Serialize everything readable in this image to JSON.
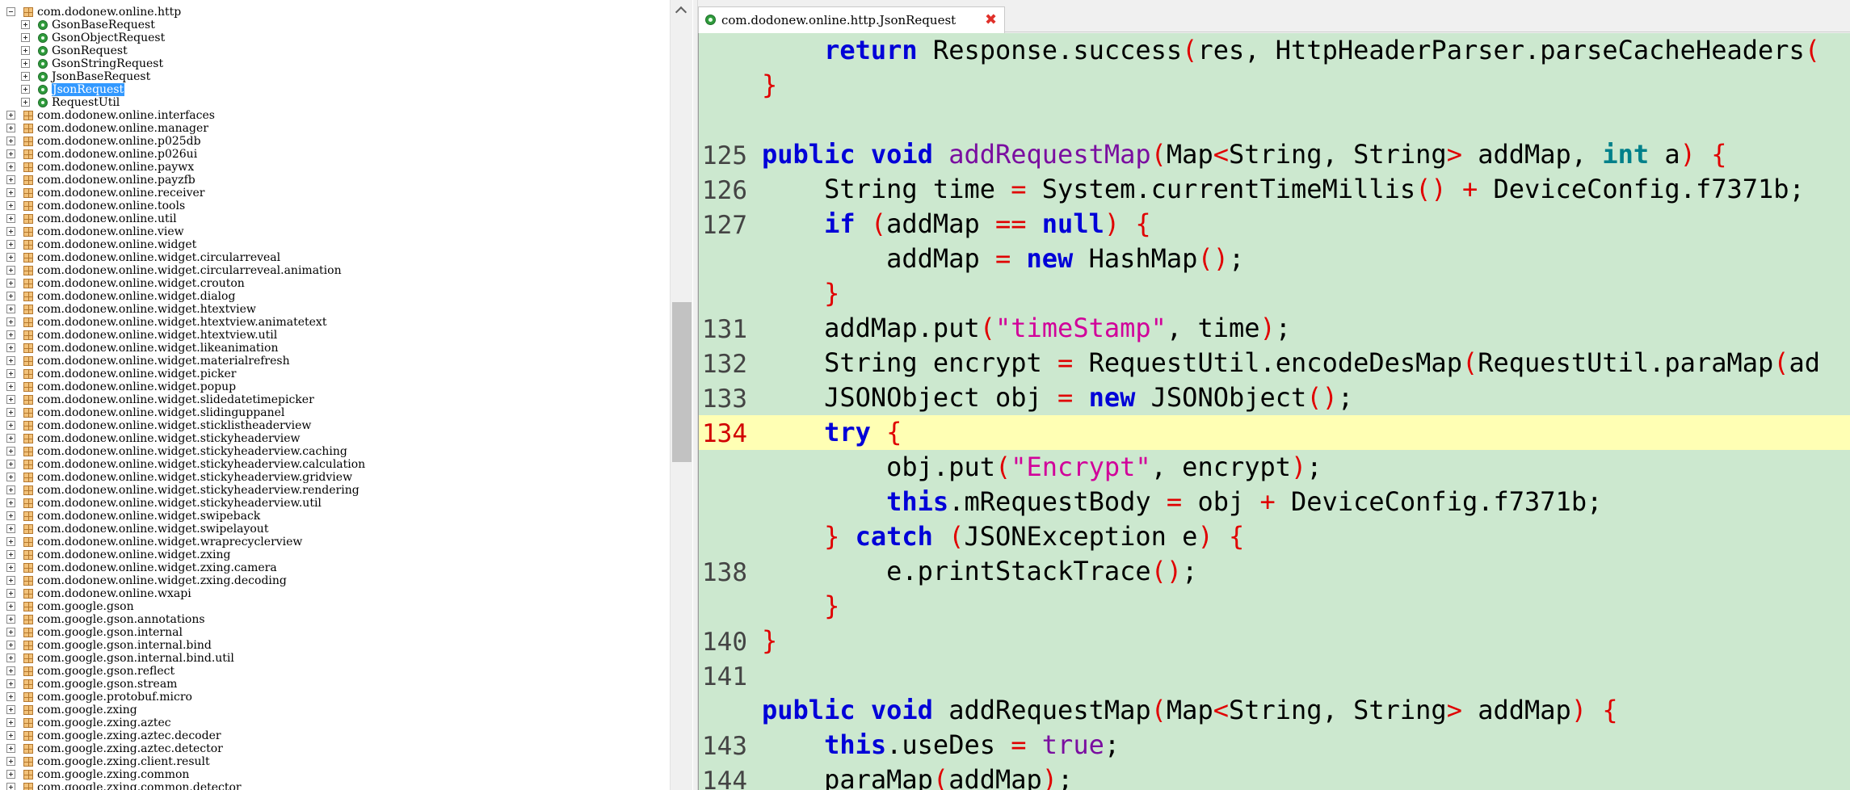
{
  "tree": {
    "items": [
      {
        "label": "com.dodonew.online.http",
        "kind": "package",
        "expanded": true
      },
      {
        "label": "GsonBaseRequest",
        "kind": "class"
      },
      {
        "label": "GsonObjectRequest",
        "kind": "class"
      },
      {
        "label": "GsonRequest",
        "kind": "class"
      },
      {
        "label": "GsonStringRequest",
        "kind": "class"
      },
      {
        "label": "JsonBaseRequest",
        "kind": "class"
      },
      {
        "label": "JsonRequest",
        "kind": "class",
        "selected": true
      },
      {
        "label": "RequestUtil",
        "kind": "class"
      },
      {
        "label": "com.dodonew.online.interfaces",
        "kind": "package"
      },
      {
        "label": "com.dodonew.online.manager",
        "kind": "package"
      },
      {
        "label": "com.dodonew.online.p025db",
        "kind": "package"
      },
      {
        "label": "com.dodonew.online.p026ui",
        "kind": "package"
      },
      {
        "label": "com.dodonew.online.paywx",
        "kind": "package"
      },
      {
        "label": "com.dodonew.online.payzfb",
        "kind": "package"
      },
      {
        "label": "com.dodonew.online.receiver",
        "kind": "package"
      },
      {
        "label": "com.dodonew.online.tools",
        "kind": "package"
      },
      {
        "label": "com.dodonew.online.util",
        "kind": "package"
      },
      {
        "label": "com.dodonew.online.view",
        "kind": "package"
      },
      {
        "label": "com.dodonew.online.widget",
        "kind": "package"
      },
      {
        "label": "com.dodonew.online.widget.circularreveal",
        "kind": "package"
      },
      {
        "label": "com.dodonew.online.widget.circularreveal.animation",
        "kind": "package"
      },
      {
        "label": "com.dodonew.online.widget.crouton",
        "kind": "package"
      },
      {
        "label": "com.dodonew.online.widget.dialog",
        "kind": "package"
      },
      {
        "label": "com.dodonew.online.widget.htextview",
        "kind": "package"
      },
      {
        "label": "com.dodonew.online.widget.htextview.animatetext",
        "kind": "package"
      },
      {
        "label": "com.dodonew.online.widget.htextview.util",
        "kind": "package"
      },
      {
        "label": "com.dodonew.online.widget.likeanimation",
        "kind": "package"
      },
      {
        "label": "com.dodonew.online.widget.materialrefresh",
        "kind": "package"
      },
      {
        "label": "com.dodonew.online.widget.picker",
        "kind": "package"
      },
      {
        "label": "com.dodonew.online.widget.popup",
        "kind": "package"
      },
      {
        "label": "com.dodonew.online.widget.slidedatetimepicker",
        "kind": "package"
      },
      {
        "label": "com.dodonew.online.widget.slidinguppanel",
        "kind": "package"
      },
      {
        "label": "com.dodonew.online.widget.sticklistheaderview",
        "kind": "package"
      },
      {
        "label": "com.dodonew.online.widget.stickyheaderview",
        "kind": "package"
      },
      {
        "label": "com.dodonew.online.widget.stickyheaderview.caching",
        "kind": "package"
      },
      {
        "label": "com.dodonew.online.widget.stickyheaderview.calculation",
        "kind": "package"
      },
      {
        "label": "com.dodonew.online.widget.stickyheaderview.gridview",
        "kind": "package"
      },
      {
        "label": "com.dodonew.online.widget.stickyheaderview.rendering",
        "kind": "package"
      },
      {
        "label": "com.dodonew.online.widget.stickyheaderview.util",
        "kind": "package"
      },
      {
        "label": "com.dodonew.online.widget.swipeback",
        "kind": "package"
      },
      {
        "label": "com.dodonew.online.widget.swipelayout",
        "kind": "package"
      },
      {
        "label": "com.dodonew.online.widget.wraprecyclerview",
        "kind": "package"
      },
      {
        "label": "com.dodonew.online.widget.zxing",
        "kind": "package"
      },
      {
        "label": "com.dodonew.online.widget.zxing.camera",
        "kind": "package"
      },
      {
        "label": "com.dodonew.online.widget.zxing.decoding",
        "kind": "package"
      },
      {
        "label": "com.dodonew.online.wxapi",
        "kind": "package"
      },
      {
        "label": "com.google.gson",
        "kind": "package"
      },
      {
        "label": "com.google.gson.annotations",
        "kind": "package"
      },
      {
        "label": "com.google.gson.internal",
        "kind": "package"
      },
      {
        "label": "com.google.gson.internal.bind",
        "kind": "package"
      },
      {
        "label": "com.google.gson.internal.bind.util",
        "kind": "package"
      },
      {
        "label": "com.google.gson.reflect",
        "kind": "package"
      },
      {
        "label": "com.google.gson.stream",
        "kind": "package"
      },
      {
        "label": "com.google.protobuf.micro",
        "kind": "package"
      },
      {
        "label": "com.google.zxing",
        "kind": "package"
      },
      {
        "label": "com.google.zxing.aztec",
        "kind": "package"
      },
      {
        "label": "com.google.zxing.aztec.decoder",
        "kind": "package"
      },
      {
        "label": "com.google.zxing.aztec.detector",
        "kind": "package"
      },
      {
        "label": "com.google.zxing.client.result",
        "kind": "package"
      },
      {
        "label": "com.google.zxing.common",
        "kind": "package"
      },
      {
        "label": "com.google.zxing.common.detector",
        "kind": "package"
      }
    ]
  },
  "editor": {
    "tab_title": "com.dodonew.online.http.JsonRequest",
    "tab_close": "✖",
    "current_line": "134",
    "lines": [
      {
        "ln": "",
        "tokens": [
          [
            "",
            "    "
          ],
          [
            "kw",
            "return"
          ],
          [
            "",
            " Response.success"
          ],
          [
            "br",
            "("
          ],
          [
            "",
            "res, HttpHeaderParser.parseCacheHeaders"
          ],
          [
            "br",
            "("
          ]
        ]
      },
      {
        "ln": "",
        "tokens": [
          [
            "br",
            "}"
          ]
        ]
      },
      {
        "ln": "",
        "tokens": []
      },
      {
        "ln": "125",
        "tokens": [
          [
            "kw",
            "public"
          ],
          [
            "",
            " "
          ],
          [
            "kw",
            "void"
          ],
          [
            "",
            " "
          ],
          [
            "mn",
            "addRequestMap"
          ],
          [
            "br",
            "("
          ],
          [
            "",
            "Map"
          ],
          [
            "br",
            "<"
          ],
          [
            "",
            "String, String"
          ],
          [
            "br",
            ">"
          ],
          [
            "",
            " addMap, "
          ],
          [
            "ty",
            "int"
          ],
          [
            "",
            " a"
          ],
          [
            "br",
            ")"
          ],
          [
            "",
            " "
          ],
          [
            "br",
            "{"
          ]
        ]
      },
      {
        "ln": "126",
        "tokens": [
          [
            "",
            "    String time "
          ],
          [
            "br",
            "="
          ],
          [
            "",
            " System.currentTimeMillis"
          ],
          [
            "br",
            "()"
          ],
          [
            "",
            " "
          ],
          [
            "br",
            "+"
          ],
          [
            "",
            " DeviceConfig.f7371b;"
          ]
        ]
      },
      {
        "ln": "127",
        "tokens": [
          [
            "",
            "    "
          ],
          [
            "kw",
            "if"
          ],
          [
            "",
            " "
          ],
          [
            "br",
            "("
          ],
          [
            "",
            "addMap "
          ],
          [
            "br",
            "=="
          ],
          [
            "",
            " "
          ],
          [
            "kw",
            "null"
          ],
          [
            "br",
            ")"
          ],
          [
            "",
            " "
          ],
          [
            "br",
            "{"
          ]
        ]
      },
      {
        "ln": "",
        "tokens": [
          [
            "",
            "        addMap "
          ],
          [
            "br",
            "="
          ],
          [
            "",
            " "
          ],
          [
            "kw",
            "new"
          ],
          [
            "",
            " HashMap"
          ],
          [
            "br",
            "()"
          ],
          [
            "",
            ";"
          ]
        ]
      },
      {
        "ln": "",
        "tokens": [
          [
            "",
            "    "
          ],
          [
            "br",
            "}"
          ]
        ]
      },
      {
        "ln": "131",
        "tokens": [
          [
            "",
            "    addMap.put"
          ],
          [
            "br",
            "("
          ],
          [
            "st",
            "\"timeStamp\""
          ],
          [
            "",
            ", time"
          ],
          [
            "br",
            ")"
          ],
          [
            "",
            ";"
          ]
        ]
      },
      {
        "ln": "132",
        "tokens": [
          [
            "",
            "    String encrypt "
          ],
          [
            "br",
            "="
          ],
          [
            "",
            " RequestUtil.encodeDesMap"
          ],
          [
            "br",
            "("
          ],
          [
            "",
            "RequestUtil.paraMap"
          ],
          [
            "br",
            "("
          ],
          [
            "",
            "ad"
          ]
        ]
      },
      {
        "ln": "133",
        "tokens": [
          [
            "",
            "    JSONObject obj "
          ],
          [
            "br",
            "="
          ],
          [
            "",
            " "
          ],
          [
            "kw",
            "new"
          ],
          [
            "",
            " JSONObject"
          ],
          [
            "br",
            "()"
          ],
          [
            "",
            ";"
          ]
        ]
      },
      {
        "ln": "134",
        "tokens": [
          [
            "",
            "    "
          ],
          [
            "kw",
            "try"
          ],
          [
            "",
            " "
          ],
          [
            "br",
            "{"
          ]
        ]
      },
      {
        "ln": "",
        "tokens": [
          [
            "",
            "        obj.put"
          ],
          [
            "br",
            "("
          ],
          [
            "st",
            "\"Encrypt\""
          ],
          [
            "",
            ", encrypt"
          ],
          [
            "br",
            ")"
          ],
          [
            "",
            ";"
          ]
        ]
      },
      {
        "ln": "",
        "tokens": [
          [
            "",
            "        "
          ],
          [
            "kw",
            "this"
          ],
          [
            "",
            ".mRequestBody "
          ],
          [
            "br",
            "="
          ],
          [
            "",
            " obj "
          ],
          [
            "br",
            "+"
          ],
          [
            "",
            " DeviceConfig.f7371b;"
          ]
        ]
      },
      {
        "ln": "",
        "tokens": [
          [
            "",
            "    "
          ],
          [
            "br",
            "}"
          ],
          [
            "",
            " "
          ],
          [
            "kw",
            "catch"
          ],
          [
            "",
            " "
          ],
          [
            "br",
            "("
          ],
          [
            "",
            "JSONException e"
          ],
          [
            "br",
            ")"
          ],
          [
            "",
            " "
          ],
          [
            "br",
            "{"
          ]
        ]
      },
      {
        "ln": "138",
        "tokens": [
          [
            "",
            "        e.printStackTrace"
          ],
          [
            "br",
            "()"
          ],
          [
            "",
            ";"
          ]
        ]
      },
      {
        "ln": "",
        "tokens": [
          [
            "",
            "    "
          ],
          [
            "br",
            "}"
          ]
        ]
      },
      {
        "ln": "140",
        "tokens": [
          [
            "br",
            "}"
          ]
        ]
      },
      {
        "ln": "141",
        "tokens": []
      },
      {
        "ln": "",
        "tokens": [
          [
            "kw",
            "public"
          ],
          [
            "",
            " "
          ],
          [
            "kw",
            "void"
          ],
          [
            "",
            " addRequestMap"
          ],
          [
            "br",
            "("
          ],
          [
            "",
            "Map"
          ],
          [
            "br",
            "<"
          ],
          [
            "",
            "String, String"
          ],
          [
            "br",
            ">"
          ],
          [
            "",
            " addMap"
          ],
          [
            "br",
            ")"
          ],
          [
            "",
            " "
          ],
          [
            "br",
            "{"
          ]
        ]
      },
      {
        "ln": "143",
        "tokens": [
          [
            "",
            "    "
          ],
          [
            "kw",
            "this"
          ],
          [
            "",
            ".useDes "
          ],
          [
            "br",
            "="
          ],
          [
            "",
            " "
          ],
          [
            "mn",
            "true"
          ],
          [
            "",
            ";"
          ]
        ]
      },
      {
        "ln": "144",
        "tokens": [
          [
            "",
            "    paraMap"
          ],
          [
            "br",
            "("
          ],
          [
            "",
            "addMap"
          ],
          [
            "br",
            ")"
          ],
          [
            "",
            ";"
          ]
        ]
      }
    ]
  }
}
